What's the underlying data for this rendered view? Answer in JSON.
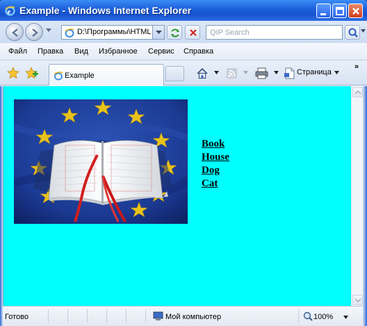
{
  "window": {
    "title": "Example - Windows Internet Explorer"
  },
  "address": {
    "url": "D:\\Программы\\HTML\\"
  },
  "search": {
    "placeholder": "QIP Search"
  },
  "menu": {
    "items": [
      {
        "label": "Файл"
      },
      {
        "label": "Правка"
      },
      {
        "label": "Вид"
      },
      {
        "label": "Избранное"
      },
      {
        "label": "Сервис"
      },
      {
        "label": "Справка"
      }
    ]
  },
  "tabs": [
    {
      "label": "Example"
    }
  ],
  "commandbar": {
    "page_label": "Страница",
    "chevron": "»"
  },
  "content": {
    "background": "#00ffff",
    "links": [
      "Book",
      "House",
      "Dog",
      "Cat"
    ]
  },
  "status": {
    "text": "Готово",
    "zone": "Мой компьютер",
    "zoom": "100%"
  },
  "icons": {
    "title": "ie-logo-icon",
    "back": "back-arrow-icon",
    "forward": "forward-arrow-icon",
    "refresh": "refresh-icon",
    "stop": "stop-icon",
    "search": "search-icon",
    "favorites": "favorites-star-icon",
    "add_favorites": "add-favorites-icon",
    "home": "home-icon",
    "feeds": "feeds-icon",
    "print": "print-icon",
    "page": "page-icon",
    "computer": "computer-icon",
    "zoom": "zoom-icon"
  }
}
